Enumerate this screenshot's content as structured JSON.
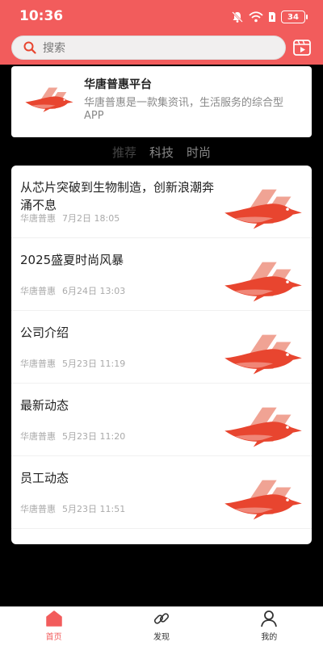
{
  "status_bar": {
    "time": "10:36",
    "battery": "34"
  },
  "search": {
    "placeholder": "搜索"
  },
  "platform_card": {
    "title": "华唐普惠平台",
    "description": "华唐普惠是一款集资讯，生活服务的综合型APP"
  },
  "tabs": [
    {
      "label": "推荐",
      "active": true
    },
    {
      "label": "科技",
      "active": false
    },
    {
      "label": "时尚",
      "active": false
    }
  ],
  "articles": [
    {
      "title": "从芯片突破到生物制造，创新浪潮奔涌不息",
      "source": "华唐普惠",
      "date": "7月2日 18:05"
    },
    {
      "title": "2025盛夏时尚风暴",
      "source": "华唐普惠",
      "date": "6月24日 13:03"
    },
    {
      "title": "公司介绍",
      "source": "华唐普惠",
      "date": "5月23日 11:19"
    },
    {
      "title": "最新动态",
      "source": "华唐普惠",
      "date": "5月23日 11:20"
    },
    {
      "title": "员工动态",
      "source": "华唐普惠",
      "date": "5月23日 11:51"
    }
  ],
  "bottom_nav": [
    {
      "label": "首页",
      "icon": "home-icon",
      "active": true
    },
    {
      "label": "发现",
      "icon": "link-icon",
      "active": false
    },
    {
      "label": "我的",
      "icon": "user-icon",
      "active": false
    }
  ],
  "colors": {
    "accent": "#f25c5c",
    "background": "#000000"
  }
}
